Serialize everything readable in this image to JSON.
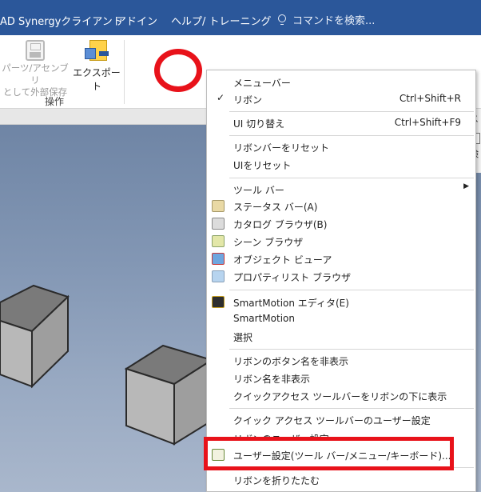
{
  "menubar": {
    "tabs": [
      "AD Synergyクライアント",
      "アドイン",
      "ヘルプ/ トレーニング"
    ],
    "search_placeholder": "コマンドを検索...",
    "search_icon": "lightbulb-icon"
  },
  "ribbon": {
    "save_external_label_1": "パーツ/アセンブリ",
    "save_external_label_2": "として外部保存",
    "export_label": "エクスポート",
    "group_label": "操作"
  },
  "right_panel": {
    "top_text": "ス",
    "bottom_text": "検"
  },
  "context_menu": {
    "items": [
      {
        "label": "メニューバー"
      },
      {
        "label": "リボン",
        "shortcut": "Ctrl+Shift+R",
        "checked": "✓"
      },
      {
        "label": "UI 切り替え",
        "shortcut": "Ctrl+Shift+F9"
      },
      {
        "label": "リボンバーをリセット"
      },
      {
        "label": "UIをリセット"
      },
      {
        "label": "ツール バー",
        "submenu": "▶"
      },
      {
        "label": "ステータス バー(A)",
        "icon": "status-bar-icon"
      },
      {
        "label": "カタログ ブラウザ(B)",
        "icon": "catalog-browser-icon"
      },
      {
        "label": "シーン ブラウザ",
        "icon": "scene-browser-icon"
      },
      {
        "label": "オブジェクト ビューア",
        "icon": "object-viewer-icon"
      },
      {
        "label": "プロパティリスト ブラウザ",
        "icon": "property-list-icon"
      },
      {
        "label": "SmartMotion エディタ(E)",
        "icon": "smartmotion-editor-icon"
      },
      {
        "label": "SmartMotion"
      },
      {
        "label": "選択"
      },
      {
        "label": "リボンのボタン名を非表示"
      },
      {
        "label": "リボン名を非表示"
      },
      {
        "label": "クイックアクセス ツールバーをリボンの下に表示"
      },
      {
        "label": "クイック アクセス ツールバーのユーザー設定"
      },
      {
        "label": "リボンのユーザー設定"
      },
      {
        "label": "ユーザー設定(ツール バー/メニュー/キーボード)...",
        "icon": "customize-icon"
      },
      {
        "label": "リボンを折りたたむ"
      }
    ]
  },
  "colors": {
    "menubar_bg": "#2b579a",
    "annotation_red": "#e8121a"
  }
}
